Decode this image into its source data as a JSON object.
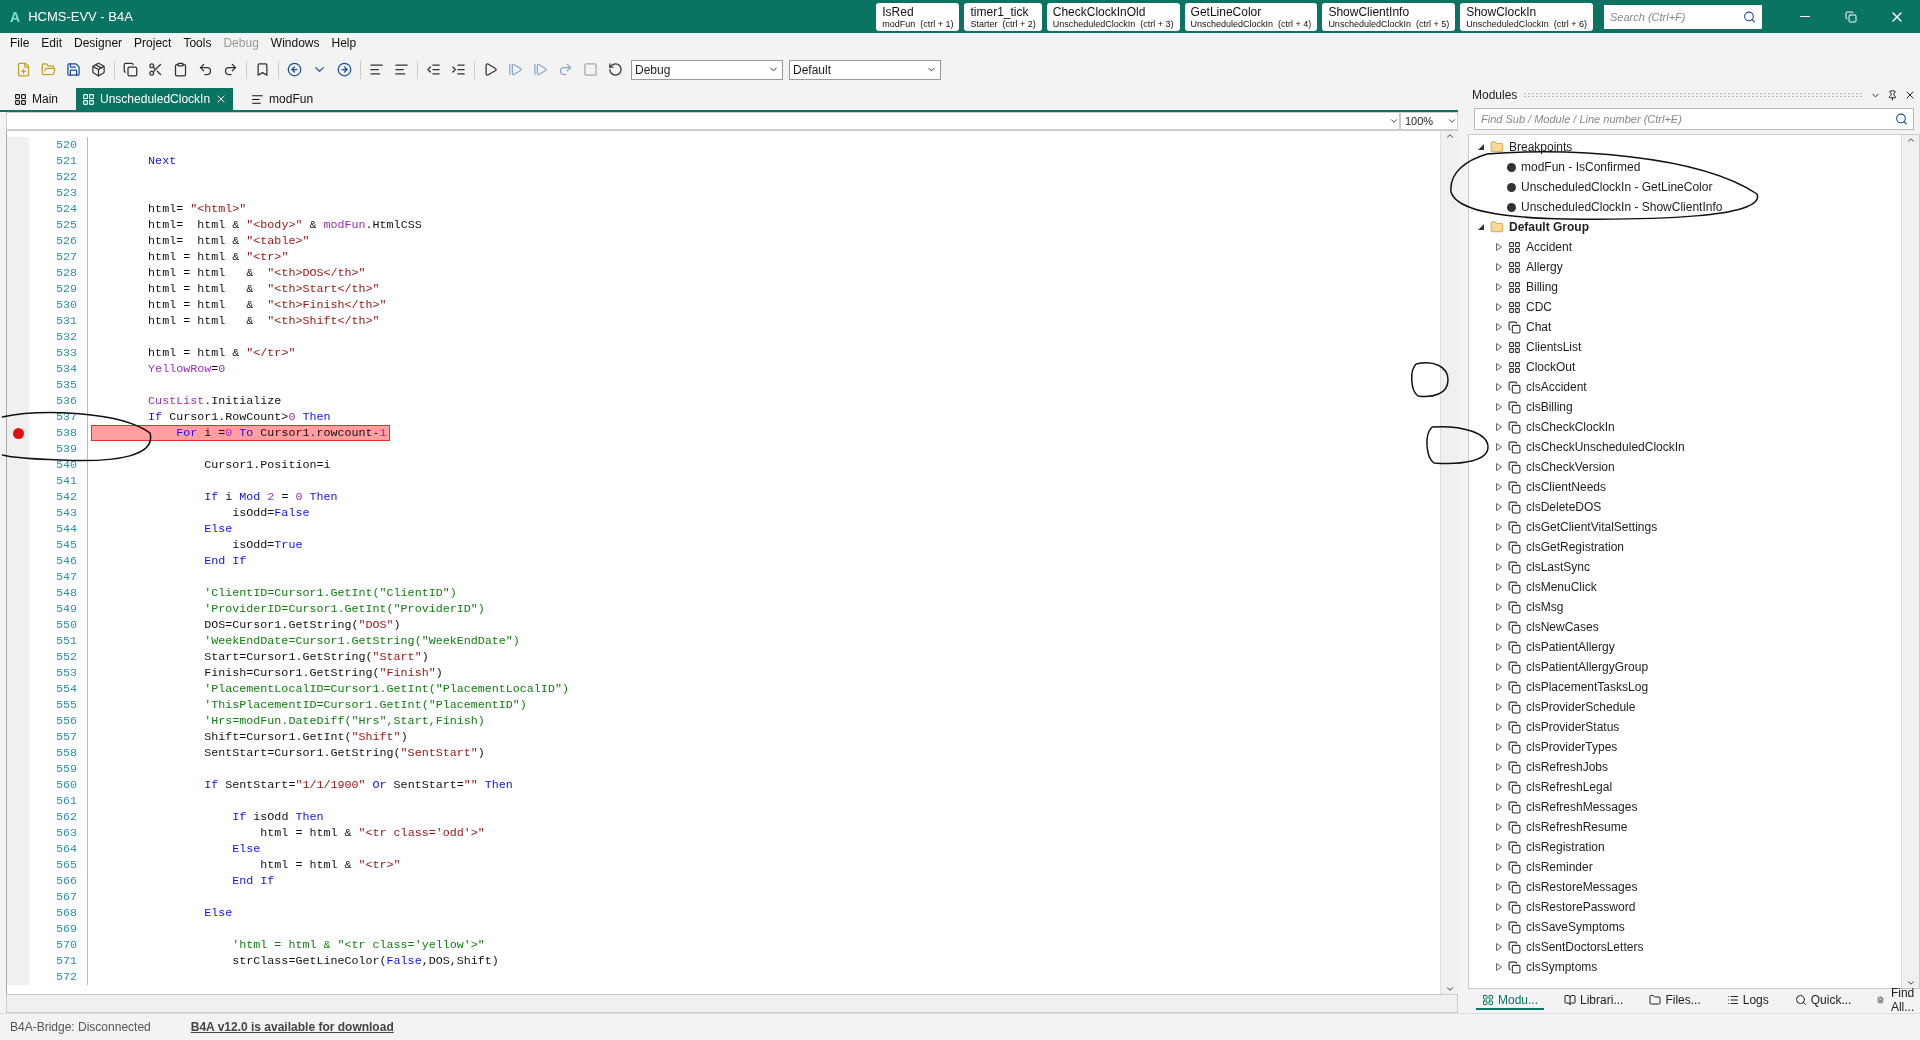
{
  "window": {
    "app_letter": "A",
    "title": "HCMS-EVV - B4A"
  },
  "quick_tabs": [
    {
      "name": "IsRed",
      "module": "modFun",
      "shortcut": "(ctrl + 1)"
    },
    {
      "name": "timer1_tick",
      "module": "Starter",
      "shortcut": "(ctrl + 2)"
    },
    {
      "name": "CheckClockInOld",
      "module": "UnscheduledClockIn",
      "shortcut": "(ctrl + 3)"
    },
    {
      "name": "GetLineColor",
      "module": "UnscheduledClockIn",
      "shortcut": "(ctrl + 4)"
    },
    {
      "name": "ShowClientInfo",
      "module": "UnscheduledClockIn",
      "shortcut": "(ctrl + 5)"
    },
    {
      "name": "ShowClockIn",
      "module": "UnscheduledClockIn",
      "shortcut": "(ctrl + 6)"
    }
  ],
  "search": {
    "placeholder": "Search (Ctrl+F)"
  },
  "menu": [
    {
      "label": "File",
      "disabled": false
    },
    {
      "label": "Edit",
      "disabled": false
    },
    {
      "label": "Designer",
      "disabled": false
    },
    {
      "label": "Project",
      "disabled": false
    },
    {
      "label": "Tools",
      "disabled": false
    },
    {
      "label": "Debug",
      "disabled": true
    },
    {
      "label": "Windows",
      "disabled": false
    },
    {
      "label": "Help",
      "disabled": false
    }
  ],
  "toolbar": {
    "build_config": "Debug",
    "build_target": "Default"
  },
  "editor_tabs": [
    {
      "label": "Main",
      "kind": "activity",
      "selected": false,
      "closable": false
    },
    {
      "label": "UnscheduledClockIn",
      "kind": "activity",
      "selected": true,
      "closable": true
    },
    {
      "label": "modFun",
      "kind": "code",
      "selected": false,
      "closable": false
    }
  ],
  "editor": {
    "zoom": "100%",
    "lines": [
      {
        "num": "520",
        "breakpoint": false
      },
      {
        "num": "521",
        "breakpoint": false,
        "segments": [
          {
            "text": "        Next",
            "kind": "keyword"
          }
        ]
      },
      {
        "num": "522",
        "breakpoint": false
      },
      {
        "num": "523",
        "breakpoint": false
      },
      {
        "num": "524",
        "breakpoint": false,
        "segments": [
          {
            "text": "        html= ",
            "kind": "plain"
          },
          {
            "text": "\"<html>\"",
            "kind": "string"
          }
        ]
      },
      {
        "num": "525",
        "breakpoint": false,
        "segments": [
          {
            "text": "        html=  html & ",
            "kind": "plain"
          },
          {
            "text": "\"<body>\"",
            "kind": "string"
          },
          {
            "text": " & ",
            "kind": "plain"
          },
          {
            "text": "modFun",
            "kind": "module"
          },
          {
            "text": ".HtmlCSS",
            "kind": "plain"
          }
        ]
      },
      {
        "num": "526",
        "breakpoint": false,
        "segments": [
          {
            "text": "        html=  html & ",
            "kind": "plain"
          },
          {
            "text": "\"<table>\"",
            "kind": "string"
          }
        ]
      },
      {
        "num": "527",
        "breakpoint": false,
        "segments": [
          {
            "text": "        html = html & ",
            "kind": "plain"
          },
          {
            "text": "\"<tr>\"",
            "kind": "string"
          }
        ]
      },
      {
        "num": "528",
        "breakpoint": false,
        "segments": [
          {
            "text": "        html = html   &  ",
            "kind": "plain"
          },
          {
            "text": "\"<th>DOS</th>\"",
            "kind": "string"
          }
        ]
      },
      {
        "num": "529",
        "breakpoint": false,
        "segments": [
          {
            "text": "        html = html   &  ",
            "kind": "plain"
          },
          {
            "text": "\"<th>Start</th>\"",
            "kind": "string"
          }
        ]
      },
      {
        "num": "530",
        "breakpoint": false,
        "segments": [
          {
            "text": "        html = html   &  ",
            "kind": "plain"
          },
          {
            "text": "\"<th>Finish</th>\"",
            "kind": "string"
          }
        ]
      },
      {
        "num": "531",
        "breakpoint": false,
        "segments": [
          {
            "text": "        html = html   &  ",
            "kind": "plain"
          },
          {
            "text": "\"<th>Shift</th>\"",
            "kind": "string"
          }
        ]
      },
      {
        "num": "532",
        "breakpoint": false
      },
      {
        "num": "533",
        "breakpoint": false,
        "segments": [
          {
            "text": "        html = html & ",
            "kind": "plain"
          },
          {
            "text": "\"</tr>\"",
            "kind": "string"
          }
        ]
      },
      {
        "num": "534",
        "breakpoint": false,
        "segments": [
          {
            "text": "        YellowRow",
            "kind": "module"
          },
          {
            "text": "=",
            "kind": "plain"
          },
          {
            "text": "0",
            "kind": "number"
          }
        ]
      },
      {
        "num": "535",
        "breakpoint": false
      },
      {
        "num": "536",
        "breakpoint": false,
        "segments": [
          {
            "text": "        CustList",
            "kind": "module"
          },
          {
            "text": ".Initialize",
            "kind": "plain"
          }
        ]
      },
      {
        "num": "537",
        "breakpoint": false,
        "segments": [
          {
            "text": "        If",
            "kind": "keyword"
          },
          {
            "text": " Cursor1.RowCount>",
            "kind": "plain"
          },
          {
            "text": "0",
            "kind": "number"
          },
          {
            "text": " Then",
            "kind": "keyword"
          }
        ]
      },
      {
        "num": "538",
        "breakpoint": true,
        "segments": [
          {
            "text": "            For",
            "kind": "keyword"
          },
          {
            "text": " i =",
            "kind": "plain"
          },
          {
            "text": "0",
            "kind": "number"
          },
          {
            "text": " To",
            "kind": "keyword"
          },
          {
            "text": " Cursor1.rowcount-",
            "kind": "plain"
          },
          {
            "text": "1",
            "kind": "number"
          }
        ]
      },
      {
        "num": "539",
        "breakpoint": false
      },
      {
        "num": "540",
        "breakpoint": false,
        "segments": [
          {
            "text": "                Cursor1.Position=i",
            "kind": "plain"
          }
        ]
      },
      {
        "num": "541",
        "breakpoint": false
      },
      {
        "num": "542",
        "breakpoint": false,
        "segments": [
          {
            "text": "                If",
            "kind": "keyword"
          },
          {
            "text": " i ",
            "kind": "plain"
          },
          {
            "text": "Mod",
            "kind": "keyword"
          },
          {
            "text": " 2",
            "kind": "number"
          },
          {
            "text": " = ",
            "kind": "plain"
          },
          {
            "text": "0",
            "kind": "number"
          },
          {
            "text": " Then",
            "kind": "keyword"
          }
        ]
      },
      {
        "num": "543",
        "breakpoint": false,
        "segments": [
          {
            "text": "                    isOdd=",
            "kind": "plain"
          },
          {
            "text": "False",
            "kind": "keyword"
          }
        ]
      },
      {
        "num": "544",
        "breakpoint": false,
        "segments": [
          {
            "text": "                Else",
            "kind": "keyword"
          }
        ]
      },
      {
        "num": "545",
        "breakpoint": false,
        "segments": [
          {
            "text": "                    isOdd=",
            "kind": "plain"
          },
          {
            "text": "True",
            "kind": "keyword"
          }
        ]
      },
      {
        "num": "546",
        "breakpoint": false,
        "segments": [
          {
            "text": "                End If",
            "kind": "keyword"
          }
        ]
      },
      {
        "num": "547",
        "breakpoint": false
      },
      {
        "num": "548",
        "breakpoint": false,
        "segments": [
          {
            "text": "                'ClientID=Cursor1.GetInt(\"ClientID\")",
            "kind": "comment"
          }
        ]
      },
      {
        "num": "549",
        "breakpoint": false,
        "segments": [
          {
            "text": "                'ProviderID=Cursor1.GetInt(\"ProviderID\")",
            "kind": "comment"
          }
        ]
      },
      {
        "num": "550",
        "breakpoint": false,
        "segments": [
          {
            "text": "                DOS=Cursor1.GetString(",
            "kind": "plain"
          },
          {
            "text": "\"DOS\"",
            "kind": "string"
          },
          {
            "text": ")",
            "kind": "plain"
          }
        ]
      },
      {
        "num": "551",
        "breakpoint": false,
        "segments": [
          {
            "text": "                'WeekEndDate=Cursor1.GetString(\"WeekEndDate\")",
            "kind": "comment"
          }
        ]
      },
      {
        "num": "552",
        "breakpoint": false,
        "segments": [
          {
            "text": "                Start=Cursor1.GetString(",
            "kind": "plain"
          },
          {
            "text": "\"Start\"",
            "kind": "string"
          },
          {
            "text": ")",
            "kind": "plain"
          }
        ]
      },
      {
        "num": "553",
        "breakpoint": false,
        "segments": [
          {
            "text": "                Finish=Cursor1.GetString(",
            "kind": "plain"
          },
          {
            "text": "\"Finish\"",
            "kind": "string"
          },
          {
            "text": ")",
            "kind": "plain"
          }
        ]
      },
      {
        "num": "554",
        "breakpoint": false,
        "segments": [
          {
            "text": "                'PlacementLocalID=Cursor1.GetInt(\"PlacementLocalID\")",
            "kind": "comment"
          }
        ]
      },
      {
        "num": "555",
        "breakpoint": false,
        "segments": [
          {
            "text": "                'ThisPlacementID=Cursor1.GetInt(\"PlacementID\")",
            "kind": "comment"
          }
        ]
      },
      {
        "num": "556",
        "breakpoint": false,
        "segments": [
          {
            "text": "                'Hrs=modFun.DateDiff(\"Hrs\",Start,Finish)",
            "kind": "comment"
          }
        ]
      },
      {
        "num": "557",
        "breakpoint": false,
        "segments": [
          {
            "text": "                Shift=Cursor1.GetInt(",
            "kind": "plain"
          },
          {
            "text": "\"Shift\"",
            "kind": "string"
          },
          {
            "text": ")",
            "kind": "plain"
          }
        ]
      },
      {
        "num": "558",
        "breakpoint": false,
        "segments": [
          {
            "text": "                SentStart=Cursor1.GetString(",
            "kind": "plain"
          },
          {
            "text": "\"SentStart\"",
            "kind": "string"
          },
          {
            "text": ")",
            "kind": "plain"
          }
        ]
      },
      {
        "num": "559",
        "breakpoint": false
      },
      {
        "num": "560",
        "breakpoint": false,
        "segments": [
          {
            "text": "                If",
            "kind": "keyword"
          },
          {
            "text": " SentStart=",
            "kind": "plain"
          },
          {
            "text": "\"1/1/1900\"",
            "kind": "string"
          },
          {
            "text": " Or",
            "kind": "keyword"
          },
          {
            "text": " SentStart=",
            "kind": "plain"
          },
          {
            "text": "\"\"",
            "kind": "string"
          },
          {
            "text": " Then",
            "kind": "keyword"
          }
        ]
      },
      {
        "num": "561",
        "breakpoint": false
      },
      {
        "num": "562",
        "breakpoint": false,
        "segments": [
          {
            "text": "                    If",
            "kind": "keyword"
          },
          {
            "text": " isOdd ",
            "kind": "plain"
          },
          {
            "text": "Then",
            "kind": "keyword"
          }
        ]
      },
      {
        "num": "563",
        "breakpoint": false,
        "segments": [
          {
            "text": "                        html = html & ",
            "kind": "plain"
          },
          {
            "text": "\"<tr class='odd'>\"",
            "kind": "string"
          }
        ]
      },
      {
        "num": "564",
        "breakpoint": false,
        "segments": [
          {
            "text": "                    Else",
            "kind": "keyword"
          }
        ]
      },
      {
        "num": "565",
        "breakpoint": false,
        "segments": [
          {
            "text": "                        html = html & ",
            "kind": "plain"
          },
          {
            "text": "\"<tr>\"",
            "kind": "string"
          }
        ]
      },
      {
        "num": "566",
        "breakpoint": false,
        "segments": [
          {
            "text": "                    End If",
            "kind": "keyword"
          }
        ]
      },
      {
        "num": "567",
        "breakpoint": false
      },
      {
        "num": "568",
        "breakpoint": false,
        "segments": [
          {
            "text": "                Else",
            "kind": "keyword"
          }
        ]
      },
      {
        "num": "569",
        "breakpoint": false
      },
      {
        "num": "570",
        "breakpoint": false,
        "segments": [
          {
            "text": "                    'html = html & \"<tr class='yellow'>\"",
            "kind": "comment"
          }
        ]
      },
      {
        "num": "571",
        "breakpoint": false,
        "segments": [
          {
            "text": "                    strClass=GetLineColor(",
            "kind": "plain"
          },
          {
            "text": "False",
            "kind": "keyword"
          },
          {
            "text": ",DOS,Shift)",
            "kind": "plain"
          }
        ]
      },
      {
        "num": "572",
        "breakpoint": false
      }
    ]
  },
  "modules": {
    "title": "Modules",
    "search_placeholder": "Find Sub / Module / Line number (Ctrl+E)",
    "tree": [
      {
        "label": "Breakpoints",
        "bold": false,
        "expanded": true,
        "children": [
          {
            "label": "modFun - IsConfirmed"
          },
          {
            "label": "UnscheduledClockIn - GetLineColor"
          },
          {
            "label": "UnscheduledClockIn - ShowClientInfo"
          }
        ]
      },
      {
        "label": "Default Group",
        "bold": true,
        "expanded": true,
        "children": [
          {
            "label": "Accident",
            "kind": "activity"
          },
          {
            "label": "Allergy",
            "kind": "activity"
          },
          {
            "label": "Billing",
            "kind": "activity"
          },
          {
            "label": "CDC",
            "kind": "activity"
          },
          {
            "label": "Chat",
            "kind": "class"
          },
          {
            "label": "ClientsList",
            "kind": "activity"
          },
          {
            "label": "ClockOut",
            "kind": "activity"
          },
          {
            "label": "clsAccident",
            "kind": "class"
          },
          {
            "label": "clsBilling",
            "kind": "class"
          },
          {
            "label": "clsCheckClockIn",
            "kind": "class"
          },
          {
            "label": "clsCheckUnscheduledClockIn",
            "kind": "class"
          },
          {
            "label": "clsCheckVersion",
            "kind": "class"
          },
          {
            "label": "clsClientNeeds",
            "kind": "class"
          },
          {
            "label": "clsDeleteDOS",
            "kind": "class"
          },
          {
            "label": "clsGetClientVitalSettings",
            "kind": "class"
          },
          {
            "label": "clsGetRegistration",
            "kind": "class"
          },
          {
            "label": "clsLastSync",
            "kind": "class"
          },
          {
            "label": "clsMenuClick",
            "kind": "class"
          },
          {
            "label": "clsMsg",
            "kind": "class"
          },
          {
            "label": "clsNewCases",
            "kind": "class"
          },
          {
            "label": "clsPatientAllergy",
            "kind": "class"
          },
          {
            "label": "clsPatientAllergyGroup",
            "kind": "class"
          },
          {
            "label": "clsPlacementTasksLog",
            "kind": "class"
          },
          {
            "label": "clsProviderSchedule",
            "kind": "class"
          },
          {
            "label": "clsProviderStatus",
            "kind": "class"
          },
          {
            "label": "clsProviderTypes",
            "kind": "class"
          },
          {
            "label": "clsRefreshJobs",
            "kind": "class"
          },
          {
            "label": "clsRefreshLegal",
            "kind": "class"
          },
          {
            "label": "clsRefreshMessages",
            "kind": "class"
          },
          {
            "label": "clsRefreshResume",
            "kind": "class"
          },
          {
            "label": "clsRegistration",
            "kind": "class"
          },
          {
            "label": "clsReminder",
            "kind": "class"
          },
          {
            "label": "clsRestoreMessages",
            "kind": "class"
          },
          {
            "label": "clsRestorePassword",
            "kind": "class"
          },
          {
            "label": "clsSaveSymptoms",
            "kind": "class"
          },
          {
            "label": "clsSentDoctorsLetters",
            "kind": "class"
          },
          {
            "label": "clsSymptoms",
            "kind": "class"
          }
        ]
      }
    ],
    "bottom_tabs": [
      {
        "label": "Modu...",
        "kind": "modules",
        "selected": true
      },
      {
        "label": "Librari...",
        "kind": "libraries",
        "selected": false
      },
      {
        "label": "Files...",
        "kind": "files",
        "selected": false
      },
      {
        "label": "Logs",
        "kind": "logs",
        "selected": false
      },
      {
        "label": "Quick...",
        "kind": "quick",
        "selected": false
      },
      {
        "label": "Find All...",
        "kind": "find",
        "selected": false
      }
    ]
  },
  "status_bar": {
    "bridge": "B4A-Bridge: Disconnected",
    "update_link": "B4A v12.0 is available for download"
  }
}
